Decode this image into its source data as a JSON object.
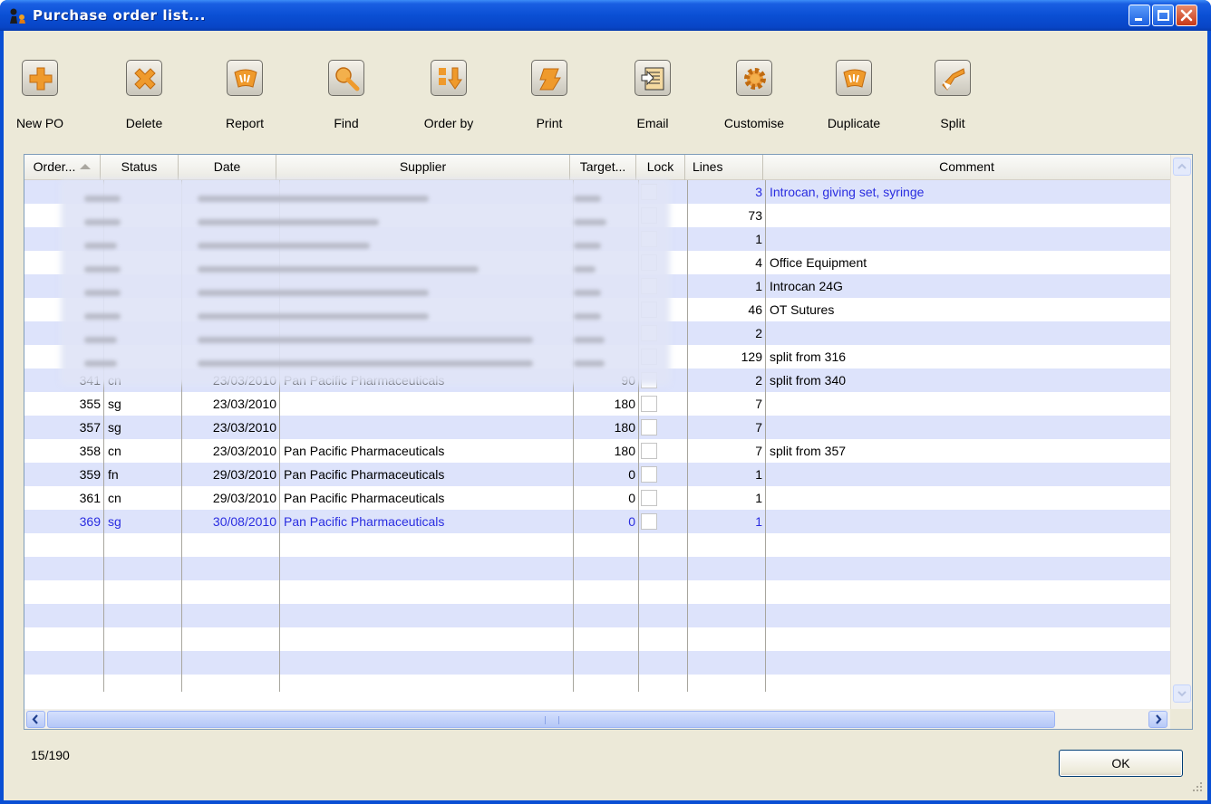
{
  "window": {
    "title": "Purchase order list..."
  },
  "toolbar": {
    "buttons": [
      {
        "label": "New PO",
        "icon": "plus-icon"
      },
      {
        "label": "Delete",
        "icon": "x-delete-icon"
      },
      {
        "label": "Report",
        "icon": "report-cards-icon"
      },
      {
        "label": "Find",
        "icon": "magnifier-icon"
      },
      {
        "label": "Order by",
        "icon": "sort-arrow-icon"
      },
      {
        "label": "Print",
        "icon": "print-icon"
      },
      {
        "label": "Email",
        "icon": "email-icon"
      },
      {
        "label": "Customise",
        "icon": "gear-icon"
      },
      {
        "label": "Duplicate",
        "icon": "duplicate-cards-icon"
      },
      {
        "label": "Split",
        "icon": "split-icon"
      }
    ]
  },
  "table": {
    "columns": [
      "Order...",
      "Status",
      "Date",
      "Supplier",
      "Target...",
      "Lock",
      "Lines",
      "Comment"
    ],
    "rows": [
      {
        "order": "",
        "status": "",
        "date": "",
        "supplier": "",
        "target": "",
        "lines": "3",
        "comment": "Introcan, giving set, syringe"
      },
      {
        "order": "",
        "status": "",
        "date": "",
        "supplier": "",
        "target": "",
        "lines": "73",
        "comment": ""
      },
      {
        "order": "",
        "status": "",
        "date": "",
        "supplier": "",
        "target": "",
        "lines": "1",
        "comment": ""
      },
      {
        "order": "",
        "status": "",
        "date": "",
        "supplier": "",
        "target": "",
        "lines": "4",
        "comment": "Office Equipment"
      },
      {
        "order": "",
        "status": "",
        "date": "",
        "supplier": "",
        "target": "",
        "lines": "1",
        "comment": "Introcan 24G"
      },
      {
        "order": "",
        "status": "",
        "date": "",
        "supplier": "",
        "target": "",
        "lines": "46",
        "comment": "OT Sutures"
      },
      {
        "order": "",
        "status": "",
        "date": "",
        "supplier": "",
        "target": "",
        "lines": "2",
        "comment": ""
      },
      {
        "order": "",
        "status": "",
        "date": "",
        "supplier": "",
        "target": "",
        "lines": "129",
        "comment": "split from 316"
      },
      {
        "order": "341",
        "status": "cn",
        "date": "23/03/2010",
        "supplier": "Pan Pacific Pharmaceuticals",
        "target": "90",
        "lines": "2",
        "comment": "split from 340"
      },
      {
        "order": "355",
        "status": "sg",
        "date": "23/03/2010",
        "supplier": "",
        "target": "180",
        "lines": "7",
        "comment": ""
      },
      {
        "order": "357",
        "status": "sg",
        "date": "23/03/2010",
        "supplier": "",
        "target": "180",
        "lines": "7",
        "comment": ""
      },
      {
        "order": "358",
        "status": "cn",
        "date": "23/03/2010",
        "supplier": "Pan Pacific Pharmaceuticals",
        "target": "180",
        "lines": "7",
        "comment": "split from 357"
      },
      {
        "order": "359",
        "status": "fn",
        "date": "29/03/2010",
        "supplier": "Pan Pacific Pharmaceuticals",
        "target": "0",
        "lines": "1",
        "comment": ""
      },
      {
        "order": "361",
        "status": "cn",
        "date": "29/03/2010",
        "supplier": "Pan Pacific Pharmaceuticals",
        "target": "0",
        "lines": "1",
        "comment": ""
      },
      {
        "order": "369",
        "status": "sg",
        "date": "30/08/2010",
        "supplier": "Pan Pacific Pharmaceuticals",
        "target": "0",
        "lines": "1",
        "comment": ""
      }
    ]
  },
  "footer": {
    "count": "15/190",
    "ok_label": "OK"
  },
  "colors": {
    "row_stripe": "#dde3fb",
    "highlight_text": "#2a2de0",
    "titlebar": "#0a4fd4",
    "dialog_bg": "#ece9d8"
  }
}
